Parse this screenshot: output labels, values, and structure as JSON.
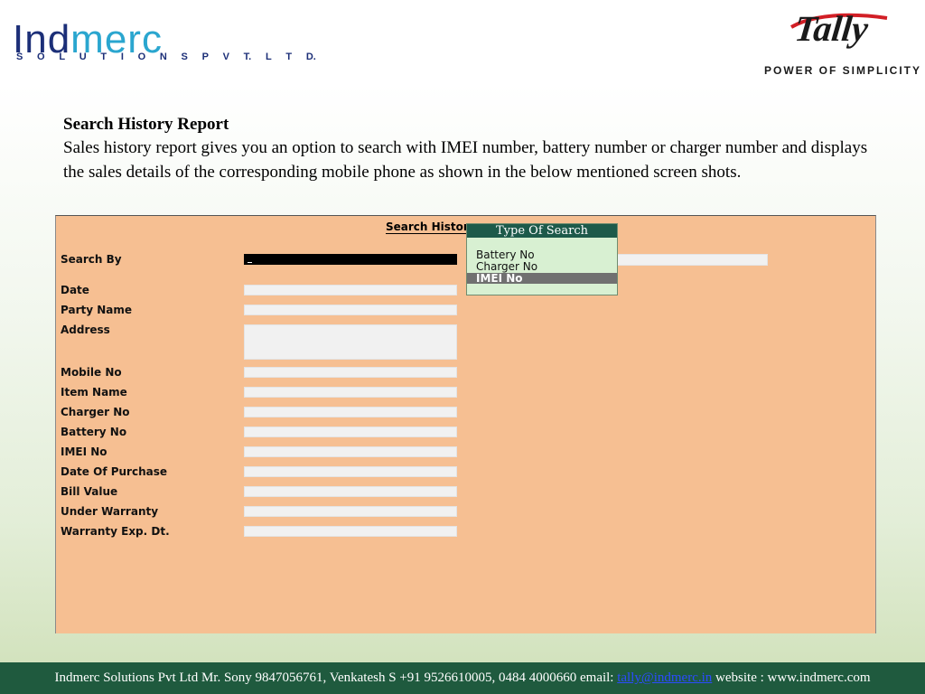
{
  "header": {
    "logo_left": {
      "word_ind": "Ind",
      "word_merc": "merc",
      "tagline": [
        "S",
        "O",
        "L",
        "U",
        "T",
        "I",
        "O",
        "N",
        "S",
        "P",
        "V",
        "T.",
        "L",
        "T",
        "D."
      ]
    },
    "logo_right": {
      "word": "Tally",
      "tagline": "POWER OF SIMPLICITY"
    }
  },
  "content": {
    "heading": "Search History Report",
    "description": "Sales history report gives you an option to search with IMEI number, battery number or charger number and displays the sales details of the corresponding mobile phone as shown in the below mentioned screen shots."
  },
  "screen": {
    "title": "Search History",
    "labels": {
      "search_by": "Search By",
      "date": "Date",
      "party_name": "Party Name",
      "address": "Address",
      "mobile_no": "Mobile No",
      "item_name": "Item Name",
      "charger_no": "Charger No",
      "battery_no": "Battery No",
      "imei_no": "IMEI No",
      "date_of_purchase": "Date Of Purchase",
      "bill_value": "Bill Value",
      "under_warranty": "Under Warranty",
      "warranty_exp_dt": "Warranty Exp. Dt."
    },
    "popup": {
      "title": "Type Of Search",
      "options": [
        "Battery No",
        "Charger No",
        "IMEI No"
      ],
      "selected": "IMEI No"
    }
  },
  "footer": {
    "text_before": "Indmerc Solutions Pvt Ltd Mr. Sony 9847056761, Venkatesh S +91 9526610005, 0484 4000660 email: ",
    "email": "tally@indmerc.in",
    "text_after": " website : www.indmerc.com"
  },
  "colors": {
    "screen_bg": "#f6bf92",
    "popup_title_bg": "#1d5a4a",
    "popup_bg": "#d8f0d2",
    "footer_bg": "#1f5a3e",
    "brand_dark": "#1c2f78",
    "brand_light": "#2aa6cf"
  }
}
